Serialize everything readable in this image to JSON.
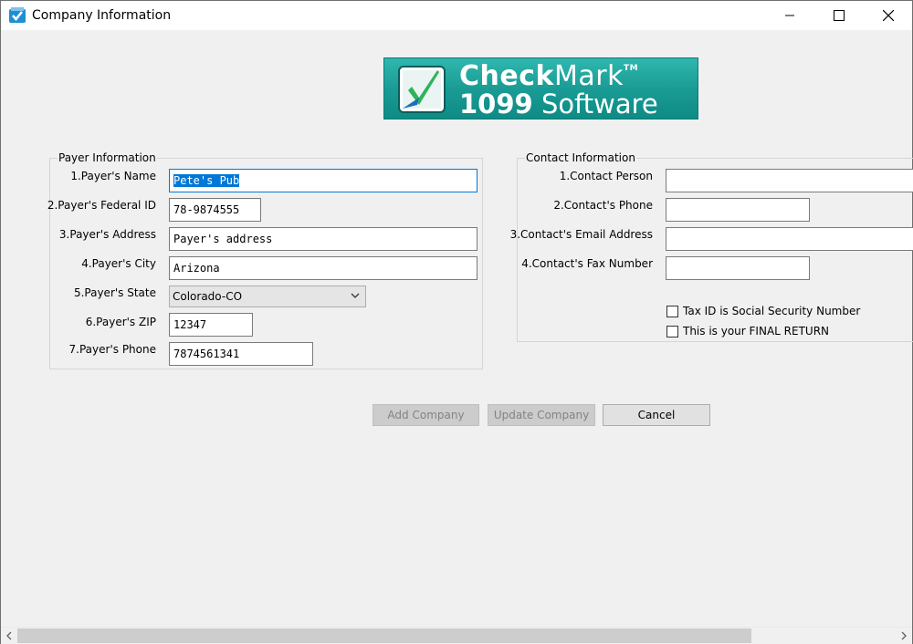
{
  "window": {
    "title": "Company Information",
    "app_icon": "checkmark-app-icon"
  },
  "logo": {
    "line1_bold": "Check",
    "line1_light": "Mark",
    "tm": "TM",
    "line2_number": "1099",
    "line2_text": "Software"
  },
  "payer": {
    "title": "Payer Information",
    "name_label": "1.Payer's Name",
    "name_value": "Pete's Pub",
    "federal_id_label": "2.Payer's Federal ID",
    "federal_id_value": "78-9874555",
    "address_label": "3.Payer's Address",
    "address_value": "Payer's address",
    "city_label": "4.Payer's City",
    "city_value": "Arizona",
    "state_label": "5.Payer's State",
    "state_value": "Colorado-CO",
    "zip_label": "6.Payer's ZIP",
    "zip_value": "12347",
    "phone_label": "7.Payer's Phone",
    "phone_value": "7874561341"
  },
  "contact": {
    "title": "Contact Information",
    "person_label": "1.Contact Person",
    "person_value": "",
    "phone_label": "2.Contact's Phone",
    "phone_value": "",
    "email_label": "3.Contact's Email Address",
    "email_value": "",
    "fax_label": "4.Contact's Fax Number",
    "fax_value": "",
    "ssn_checkbox": "Tax ID is Social Security Number",
    "ssn_checked": false,
    "final_checkbox": "This is your FINAL RETURN",
    "final_checked": false
  },
  "buttons": {
    "add": "Add Company",
    "update": "Update Company",
    "cancel": "Cancel"
  },
  "colors": {
    "accent": "#0078d7",
    "logo_teal": "#1a9c95"
  }
}
